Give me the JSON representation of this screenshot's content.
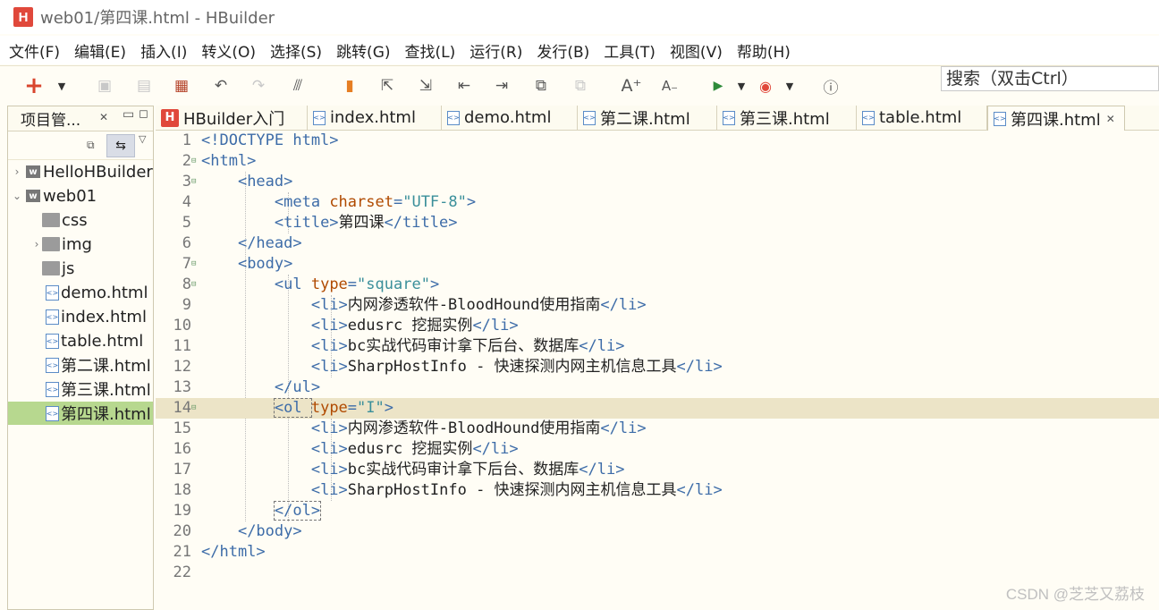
{
  "window": {
    "title": "web01/第四课.html  -  HBuilder",
    "logo": "H"
  },
  "menu": [
    "文件(F)",
    "编辑(E)",
    "插入(I)",
    "转义(O)",
    "选择(S)",
    "跳转(G)",
    "查找(L)",
    "运行(R)",
    "发行(B)",
    "工具(T)",
    "视图(V)",
    "帮助(H)"
  ],
  "search": {
    "placeholder": "搜索（双击Ctrl）"
  },
  "project_panel": {
    "title": "项目管...",
    "tree": [
      {
        "label": "HelloHBuilder",
        "kind": "project",
        "twisty": "›"
      },
      {
        "label": "web01",
        "kind": "project",
        "twisty": "⌄"
      },
      {
        "label": "css",
        "kind": "folder",
        "twisty": ""
      },
      {
        "label": "img",
        "kind": "folder",
        "twisty": "›"
      },
      {
        "label": "js",
        "kind": "folder",
        "twisty": ""
      },
      {
        "label": "demo.html",
        "kind": "file",
        "twisty": ""
      },
      {
        "label": "index.html",
        "kind": "file",
        "twisty": ""
      },
      {
        "label": "table.html",
        "kind": "file",
        "twisty": ""
      },
      {
        "label": "第二课.html",
        "kind": "file",
        "twisty": ""
      },
      {
        "label": "第三课.html",
        "kind": "file",
        "twisty": ""
      },
      {
        "label": "第四课.html",
        "kind": "file",
        "twisty": "",
        "selected": true
      }
    ]
  },
  "tabs": [
    {
      "label": "HBuilder入门",
      "icon": "hbuilder-logo-icon"
    },
    {
      "label": "index.html",
      "icon": "html-file-icon"
    },
    {
      "label": "demo.html",
      "icon": "html-file-icon"
    },
    {
      "label": "第二课.html",
      "icon": "html-file-icon"
    },
    {
      "label": "第三课.html",
      "icon": "html-file-icon"
    },
    {
      "label": "table.html",
      "icon": "html-file-icon"
    },
    {
      "label": "第四课.html",
      "icon": "html-file-icon",
      "active": true
    }
  ],
  "editor": {
    "highlighted_line": 14,
    "lines": [
      {
        "n": "1",
        "fold": "",
        "indent": "",
        "parts": [
          [
            "t",
            "<!DOCTYPE html>"
          ]
        ]
      },
      {
        "n": "2",
        "fold": "⊟",
        "indent": "",
        "parts": [
          [
            "t",
            "<html>"
          ]
        ]
      },
      {
        "n": "3",
        "fold": "⊟",
        "indent": "    ",
        "parts": [
          [
            "t",
            "<head>"
          ]
        ]
      },
      {
        "n": "4",
        "fold": "",
        "indent": "        ",
        "parts": [
          [
            "t",
            "<meta "
          ],
          [
            "a",
            "charset"
          ],
          [
            "t",
            "="
          ],
          [
            "s",
            "\"UTF-8\""
          ],
          [
            "t",
            ">"
          ]
        ]
      },
      {
        "n": "5",
        "fold": "",
        "indent": "        ",
        "parts": [
          [
            "t",
            "<title>"
          ],
          [
            "tx",
            "第四课"
          ],
          [
            "t",
            "</title>"
          ]
        ]
      },
      {
        "n": "6",
        "fold": "",
        "indent": "    ",
        "parts": [
          [
            "t",
            "</head>"
          ]
        ]
      },
      {
        "n": "7",
        "fold": "⊟",
        "indent": "    ",
        "parts": [
          [
            "t",
            "<body>"
          ]
        ]
      },
      {
        "n": "8",
        "fold": "⊟",
        "indent": "        ",
        "parts": [
          [
            "t",
            "<ul "
          ],
          [
            "a",
            "type"
          ],
          [
            "t",
            "="
          ],
          [
            "s",
            "\"square\""
          ],
          [
            "t",
            ">"
          ]
        ]
      },
      {
        "n": "9",
        "fold": "",
        "indent": "            ",
        "parts": [
          [
            "t",
            "<li>"
          ],
          [
            "tx",
            "内网渗透软件-BloodHound使用指南"
          ],
          [
            "t",
            "</li>"
          ]
        ]
      },
      {
        "n": "10",
        "fold": "",
        "indent": "            ",
        "parts": [
          [
            "t",
            "<li>"
          ],
          [
            "tx",
            "edusrc 挖掘实例"
          ],
          [
            "t",
            "</li>"
          ]
        ]
      },
      {
        "n": "11",
        "fold": "",
        "indent": "            ",
        "parts": [
          [
            "t",
            "<li>"
          ],
          [
            "tx",
            "bc实战代码审计拿下后台、数据库"
          ],
          [
            "t",
            "</li>"
          ]
        ]
      },
      {
        "n": "12",
        "fold": "",
        "indent": "            ",
        "parts": [
          [
            "t",
            "<li>"
          ],
          [
            "tx",
            "SharpHostInfo - 快速探测内网主机信息工具"
          ],
          [
            "t",
            "</li>"
          ]
        ]
      },
      {
        "n": "13",
        "fold": "",
        "indent": "        ",
        "parts": [
          [
            "t",
            "</ul>"
          ]
        ]
      },
      {
        "n": "14",
        "fold": "⊟",
        "indent": "        ",
        "parts": [
          [
            "t",
            "<ol "
          ],
          [
            "a",
            "type"
          ],
          [
            "t",
            "="
          ],
          [
            "s",
            "\"I\""
          ],
          [
            "t",
            ">"
          ]
        ]
      },
      {
        "n": "15",
        "fold": "",
        "indent": "            ",
        "parts": [
          [
            "t",
            "<li>"
          ],
          [
            "tx",
            "内网渗透软件-BloodHound使用指南"
          ],
          [
            "t",
            "</li>"
          ]
        ]
      },
      {
        "n": "16",
        "fold": "",
        "indent": "            ",
        "parts": [
          [
            "t",
            "<li>"
          ],
          [
            "tx",
            "edusrc 挖掘实例"
          ],
          [
            "t",
            "</li>"
          ]
        ]
      },
      {
        "n": "17",
        "fold": "",
        "indent": "            ",
        "parts": [
          [
            "t",
            "<li>"
          ],
          [
            "tx",
            "bc实战代码审计拿下后台、数据库"
          ],
          [
            "t",
            "</li>"
          ]
        ]
      },
      {
        "n": "18",
        "fold": "",
        "indent": "            ",
        "parts": [
          [
            "t",
            "<li>"
          ],
          [
            "tx",
            "SharpHostInfo - 快速探测内网主机信息工具"
          ],
          [
            "t",
            "</li>"
          ]
        ]
      },
      {
        "n": "19",
        "fold": "",
        "indent": "        ",
        "parts": [
          [
            "t",
            "</ol>"
          ]
        ]
      },
      {
        "n": "20",
        "fold": "",
        "indent": "    ",
        "parts": [
          [
            "t",
            "</body>"
          ]
        ]
      },
      {
        "n": "21",
        "fold": "",
        "indent": "",
        "parts": [
          [
            "t",
            "</html>"
          ]
        ]
      },
      {
        "n": "22",
        "fold": "",
        "indent": "",
        "parts": []
      }
    ]
  },
  "watermark": "CSDN @芝芝又荔枝"
}
